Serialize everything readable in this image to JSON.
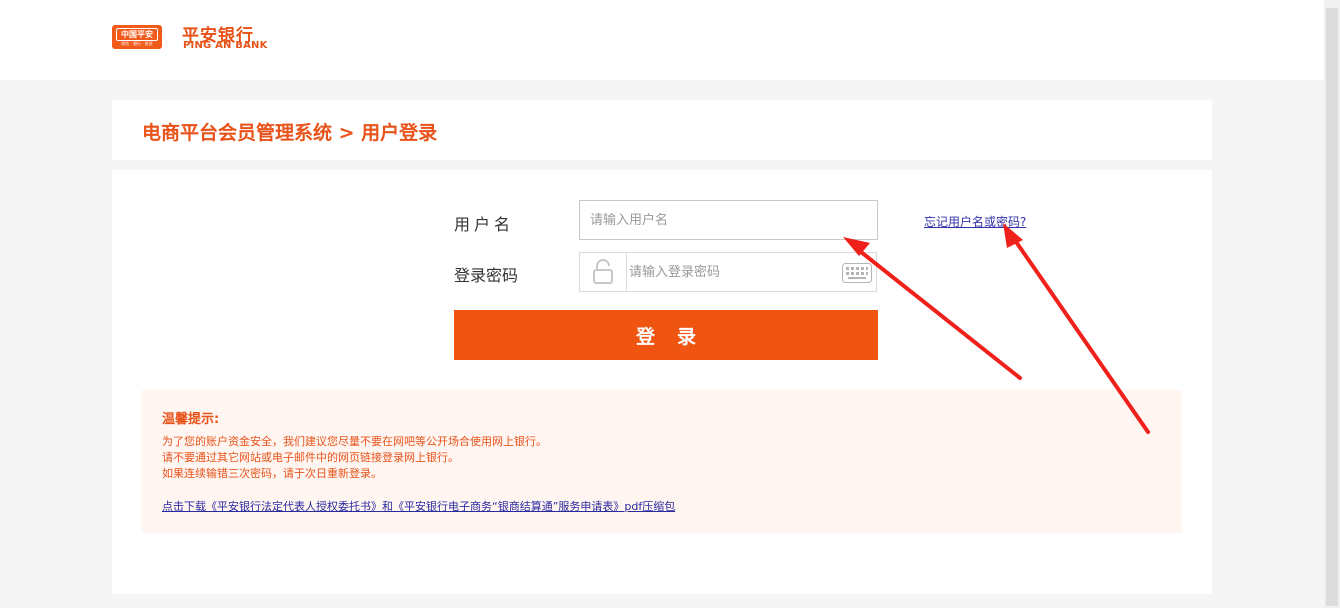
{
  "header": {
    "logo_badge_cn": "中国平安",
    "logo_badge_sub": "保险 · 银行 · 投资",
    "logo_cn": "平安银行",
    "logo_en": "PING AN BANK"
  },
  "page": {
    "title": "电商平台会员管理系统 > 用户登录"
  },
  "form": {
    "username_label": "用户名",
    "username_placeholder": "请输入用户名",
    "password_label": "登录密码",
    "password_placeholder": "请输入登录密码",
    "forgot_link": "忘记用户名或密码?",
    "login_button": "登录",
    "icons": [
      "lock-icon",
      "keyboard-icon"
    ]
  },
  "tips": {
    "title": "温馨提示:",
    "lines": [
      "为了您的账户资金安全，我们建议您尽量不要在网吧等公开场合使用网上银行。",
      "请不要通过其它网站或电子邮件中的网页链接登录网上银行。",
      "如果连续输错三次密码，请于次日重新登录。"
    ],
    "download_link": "点击下载《平安银行法定代表人授权委托书》和《平安银行电子商务“银商结算通”服务申请表》pdf压缩包"
  },
  "colors": {
    "brand": "#e8531a",
    "button": "#ef5410",
    "tips_bg": "#fff5f1",
    "annotation_arrow": "#f0201a"
  }
}
